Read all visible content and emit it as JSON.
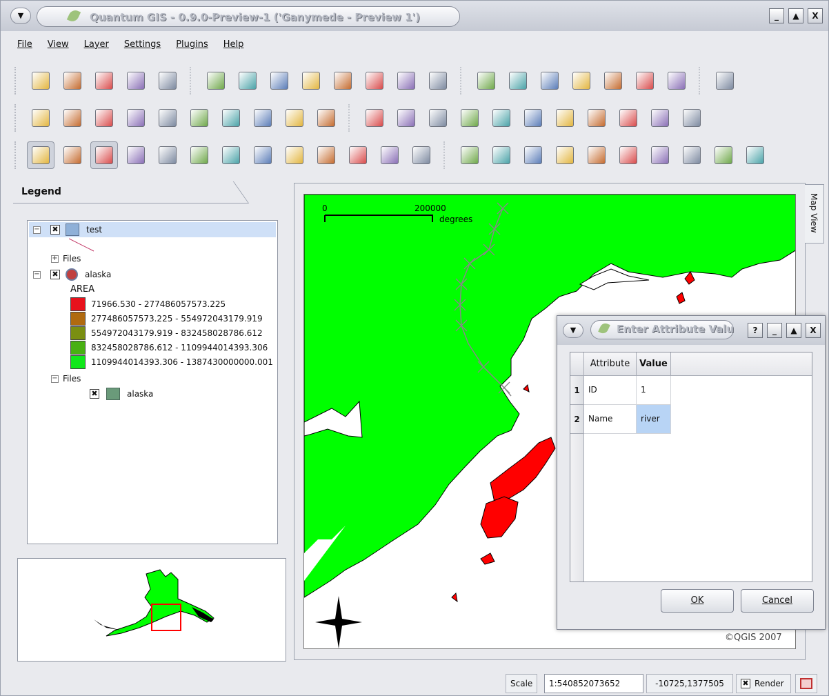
{
  "window": {
    "title": "Quantum GIS - 0.9.0-Preview-1 ('Ganymede - Preview 1')",
    "menu_glyph": "▼",
    "controls": [
      "_",
      "▲",
      "X"
    ]
  },
  "menu": [
    "File",
    "View",
    "Layer",
    "Settings",
    "Plugins",
    "Help"
  ],
  "toolbars": {
    "row1": [
      "new-project-icon",
      "save-project-icon",
      "save-as-icon",
      "open-project-icon",
      "print-icon",
      "pan-icon",
      "zoom-in-icon",
      "zoom-out-icon",
      "zoom-full-icon",
      "zoom-selection-icon",
      "zoom-layer-icon",
      "zoom-last-icon",
      "refresh-icon",
      "identify-icon",
      "select-features-icon",
      "attribute-table-icon",
      "measure-line-icon",
      "measure-area-icon",
      "show-bookmarks-icon",
      "new-bookmark-icon",
      "help-icon"
    ],
    "row2": [
      "scalebar-icon",
      "copyright-icon",
      "north-arrow-icon",
      "gps-icon",
      "georeferencer-icon",
      "grid-maker-icon",
      "north-arrow-plugin-icon",
      "compass-icon",
      "wfs-icon",
      "spit-icon",
      "add-vector-icon",
      "add-raster-icon",
      "add-postgis-icon",
      "add-wms-icon",
      "new-layer-icon",
      "remove-layer-icon",
      "show-all-icon",
      "hide-all-icon",
      "in-overview-icon",
      "add-all-overview-icon",
      "remove-all-overview-icon"
    ],
    "row3": [
      "toggle-editing-icon",
      "capture-point-icon",
      "capture-line-icon",
      "capture-polygon-icon",
      "delete-selected-icon",
      "add-ring-icon",
      "add-island-icon",
      "move-feature-icon",
      "split-feature-icon",
      "delete-vertex-icon",
      "cut-icon",
      "copy-icon",
      "paste-icon",
      "raster-tool-icon",
      "raster-tool-2-icon",
      "move-vertex-icon",
      "add-vertex-icon",
      "delete-part-icon",
      "reshape-icon",
      "select-icon",
      "add-feature-icon",
      "edit-feature-icon",
      "stop-render-icon"
    ]
  },
  "legend": {
    "tab_label": "Legend",
    "layers": [
      {
        "name": "test",
        "checked": "✖",
        "files_label": "Files"
      },
      {
        "name": "alaska",
        "checked": "✖",
        "field": "AREA",
        "classes": [
          {
            "label": "71966.530 - 277486057573.225",
            "color": "#e8121c"
          },
          {
            "label": "277486057573.225 - 554972043179.919",
            "color": "#b06a10"
          },
          {
            "label": "554972043179.919 - 832458028786.612",
            "color": "#7a8f12"
          },
          {
            "label": "832458028786.612 - 1109944014393.306",
            "color": "#48b012"
          },
          {
            "label": "1109944014393.306 - 1387430000000.001",
            "color": "#10e81a"
          }
        ],
        "files_label": "Files",
        "file_name": "alaska"
      }
    ]
  },
  "map": {
    "tab_label": "Map View",
    "scalebar_zero": "0",
    "scalebar_value": "200000",
    "scalebar_unit": "degrees",
    "copyright": "©QGIS 2007",
    "land_color": "#00ff00",
    "red_color": "#ff0000"
  },
  "dialog": {
    "title": "Enter Attribute Valu",
    "controls": [
      "?",
      "_",
      "▲",
      "X"
    ],
    "columns": [
      "Attribute",
      "Value"
    ],
    "rows": [
      {
        "num": "1",
        "attribute": "ID",
        "value": "1"
      },
      {
        "num": "2",
        "attribute": "Name",
        "value": "river"
      }
    ],
    "ok_label": "OK",
    "cancel_label": "Cancel"
  },
  "status": {
    "scale_label": "Scale",
    "scale_value": "1:540852073652",
    "coordinates": "-10725,1377505",
    "render_checked": "✖",
    "render_label": "Render"
  }
}
